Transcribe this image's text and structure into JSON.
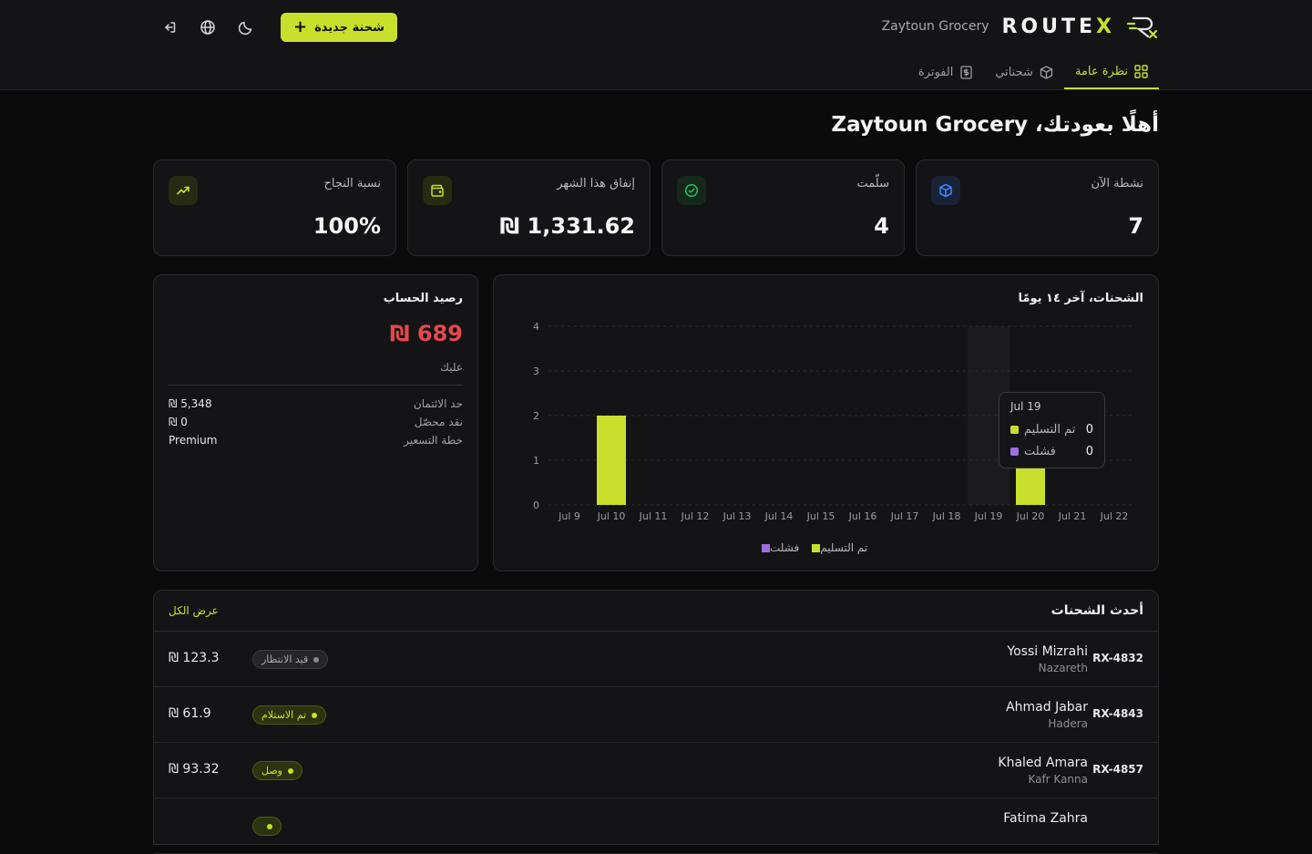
{
  "header": {
    "org_name": "Zaytoun Grocery",
    "logo_text_main": "ROUTE",
    "logo_text_x": "X",
    "new_shipment_label": "شحنة جديدة"
  },
  "tabs": [
    {
      "label": "نظرة عامة",
      "icon": "grid-icon",
      "active": true
    },
    {
      "label": "شحناتي",
      "icon": "box-icon",
      "active": false
    },
    {
      "label": "الفوترة",
      "icon": "invoice-icon",
      "active": false
    }
  ],
  "page_title": "أهلًا بعودتك، Zaytoun Grocery",
  "stats": [
    {
      "label": "نشطة الآن",
      "value": "7",
      "icon": "cube-icon",
      "accent": "#3b82f6"
    },
    {
      "label": "سلّمت",
      "value": "4",
      "icon": "check-circle-icon",
      "accent": "#22c55e"
    },
    {
      "label": "إنفاق هذا الشهر",
      "value": "₪ 1,331.62",
      "icon": "wallet-icon",
      "accent": "#c8e02c"
    },
    {
      "label": "نسبة النجاح",
      "value": "100%",
      "icon": "trend-up-icon",
      "accent": "#c8e02c"
    }
  ],
  "balance": {
    "title": "رصيد الحساب",
    "amount": "₪ 689",
    "sub": "عليك",
    "rows": [
      {
        "key": "حد الائتمان",
        "value": "₪ 5,348"
      },
      {
        "key": "نقد محصّل",
        "value": "₪ 0"
      },
      {
        "key": "خطة التسعير",
        "value": "Premium"
      }
    ]
  },
  "chart_title": "الشحنات، آخر ١٤ يومًا",
  "chart_data": {
    "type": "bar",
    "categories": [
      "Jul 9",
      "Jul 10",
      "Jul 11",
      "Jul 12",
      "Jul 13",
      "Jul 14",
      "Jul 15",
      "Jul 16",
      "Jul 17",
      "Jul 18",
      "Jul 19",
      "Jul 20",
      "Jul 21",
      "Jul 22"
    ],
    "series": [
      {
        "name": "تم التسليم",
        "color": "#c8e02c",
        "values": [
          0,
          2,
          0,
          0,
          0,
          0,
          0,
          0,
          0,
          0,
          0,
          1,
          0,
          0
        ]
      },
      {
        "name": "فشلت",
        "color": "#9f6fe0",
        "values": [
          0,
          0,
          0,
          0,
          0,
          0,
          0,
          0,
          0,
          0,
          0,
          0,
          0,
          0
        ]
      }
    ],
    "ylim": [
      0,
      4
    ],
    "yticks": [
      "0",
      "1",
      "2",
      "3",
      "4"
    ],
    "grid": true,
    "legend": "bottom-center",
    "highlight_category": "Jul 19"
  },
  "tooltip": {
    "title": "Jul 19",
    "rows": [
      {
        "label": "تم التسليم",
        "value": "0",
        "color": "#c8e02c"
      },
      {
        "label": "فشلت",
        "value": "0",
        "color": "#9f6fe0"
      }
    ]
  },
  "recent": {
    "title": "أحدث الشحنات",
    "view_all": "عرض الكل",
    "rows": [
      {
        "id": "RX-4832",
        "name": "Yossi Mizrahi",
        "city": "Nazareth",
        "status": "قيد الانتظار",
        "status_kind": "pending",
        "amount": "₪ 123.3"
      },
      {
        "id": "RX-4843",
        "name": "Ahmad Jabar",
        "city": "Hadera",
        "status": "تم الاستلام",
        "status_kind": "green",
        "amount": "₪ 61.9"
      },
      {
        "id": "RX-4857",
        "name": "Khaled Amara",
        "city": "Kafr Kanna",
        "status": "وصل",
        "status_kind": "green",
        "amount": "₪ 93.32"
      },
      {
        "id": "",
        "name": "Fatima Zahra",
        "city": "",
        "status": "",
        "status_kind": "green",
        "amount": ""
      }
    ]
  }
}
